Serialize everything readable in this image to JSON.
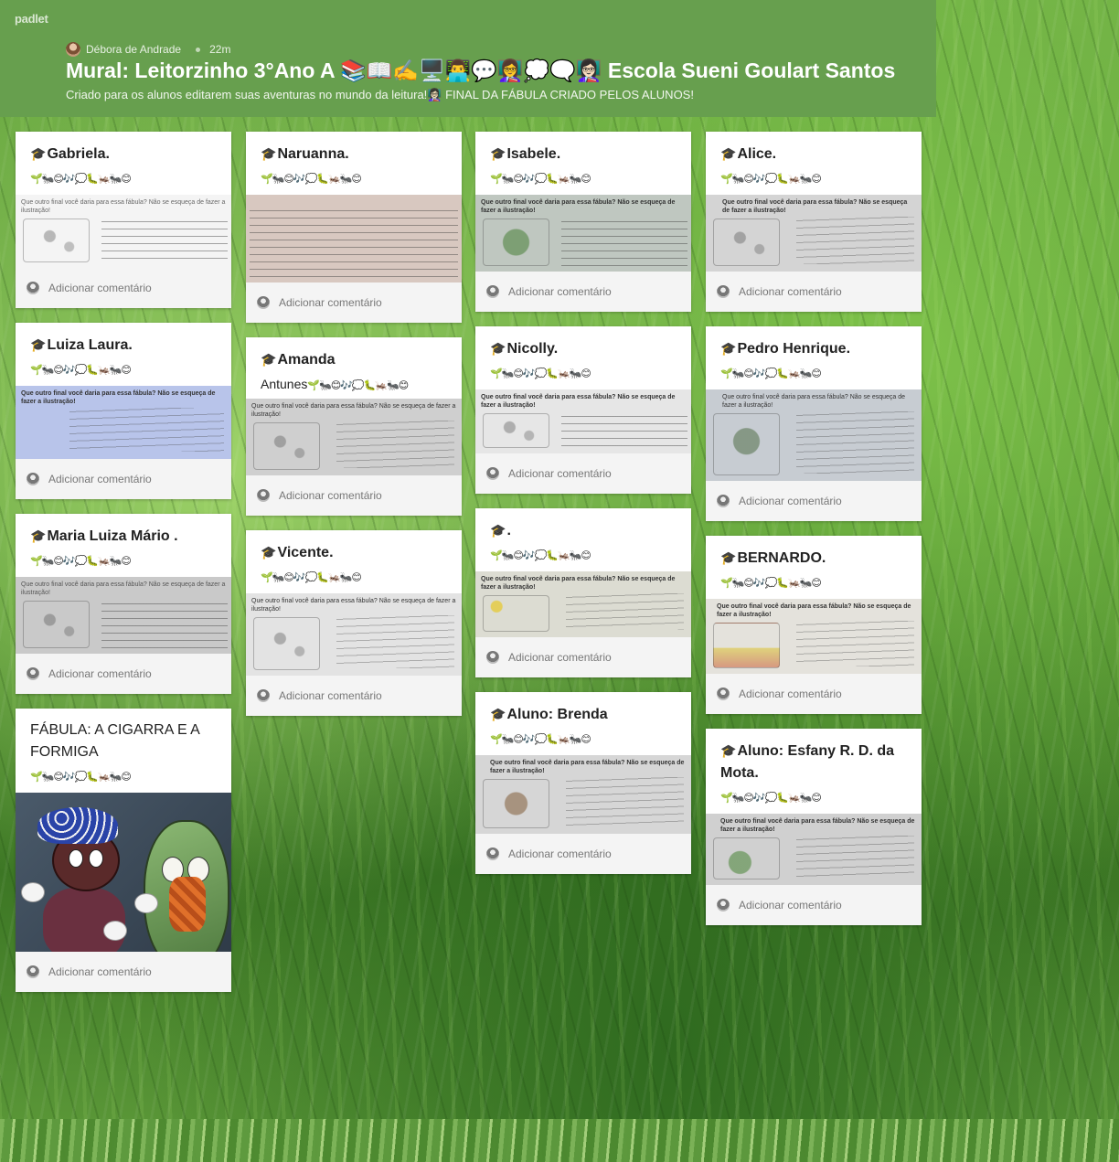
{
  "app": {
    "brand": "padlet"
  },
  "header": {
    "author": "Débora de Andrade",
    "time": "22m",
    "title": "Mural: Leitorzinho 3°Ano A 📚📖✍️🖥️👨‍💻💬👩‍🏫💭🗨️👩🏻‍🏫 Escola Sueni Goulart Santos",
    "subtitle": "Criado para os alunos editarem suas aventuras no mundo da leitura!👩🏻‍🏫 FINAL DA FÁBULA CRIADO PELOS ALUNOS!"
  },
  "common": {
    "cap": "🎓",
    "emoji_line": "🌱🐜😊🎶💭🐛🦗🐜😊",
    "question": "Que outro final você daria para essa fábula? Não se esqueça de fazer a ilustração!",
    "comment_label": "Adicionar comentário"
  },
  "columns": [
    [
      {
        "title": "Gabriela."
      },
      {
        "title": "Luiza Laura."
      },
      {
        "title": "Maria Luiza Mário ."
      },
      {
        "title": "FÁBULA: A CIGARRA E A FORMIGA"
      }
    ],
    [
      {
        "title": "Naruanna."
      },
      {
        "title": "Amanda",
        "title2": "Antunes"
      },
      {
        "title": "Vicente."
      }
    ],
    [
      {
        "title": "Isabele."
      },
      {
        "title": "Nicolly."
      },
      {
        "title": "."
      },
      {
        "title": "Aluno: Brenda"
      }
    ],
    [
      {
        "title": "Alice."
      },
      {
        "title": "Pedro Henrique."
      },
      {
        "title": "BERNARDO."
      },
      {
        "title": "Aluno: Esfany R. D. da Mota."
      }
    ]
  ],
  "colors": {
    "header_bg": "#679f4e",
    "card_bg": "#ffffff",
    "footer_bg": "#f4f4f4"
  }
}
